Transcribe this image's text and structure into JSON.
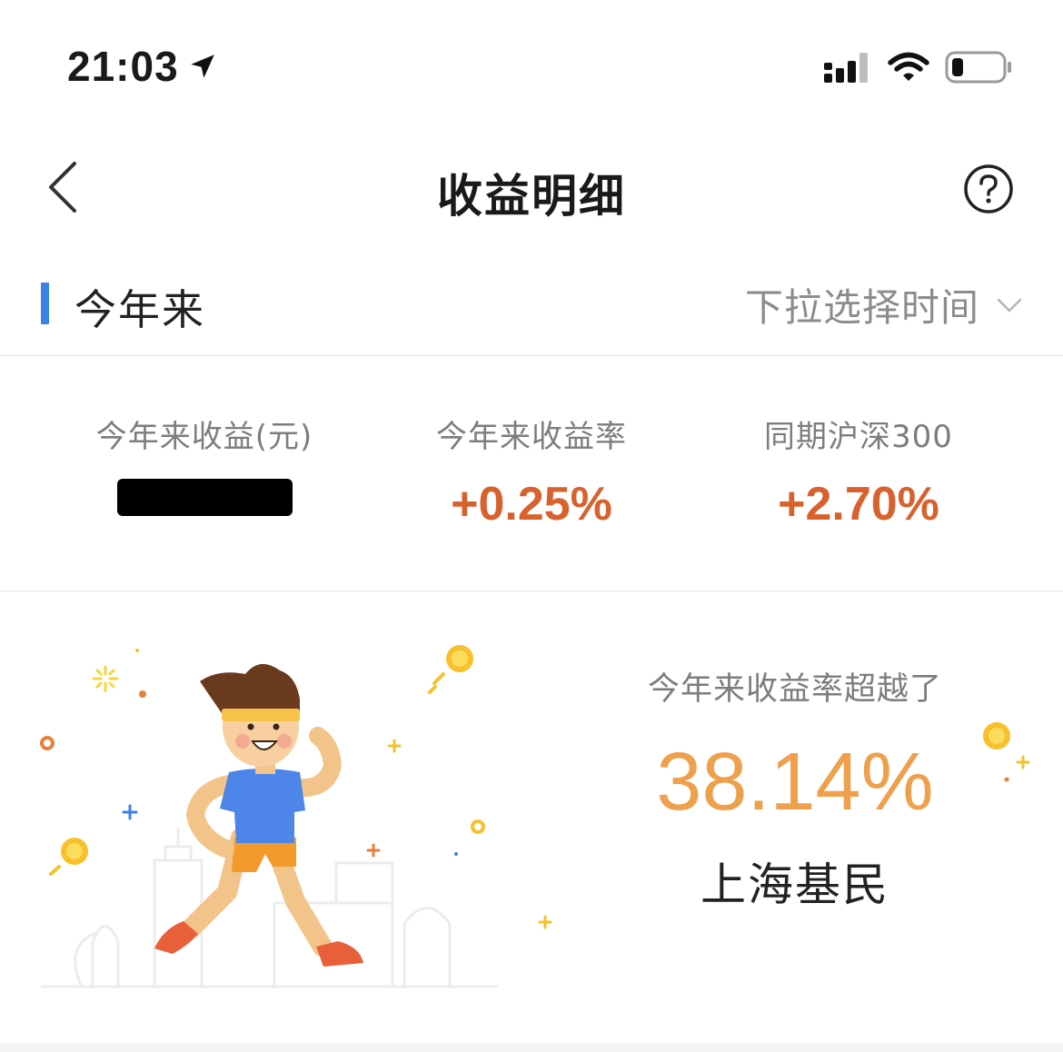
{
  "status_bar": {
    "time": "21:03",
    "icons": [
      "location-arrow-icon",
      "cellular-signal-icon",
      "wifi-icon",
      "battery-icon"
    ]
  },
  "nav": {
    "title": "收益明细",
    "back_icon": "chevron-left-icon",
    "help_icon": "question-circle-icon"
  },
  "period": {
    "label": "今年来",
    "select_placeholder": "下拉选择时间",
    "accent_color": "#3b82e6"
  },
  "stats": [
    {
      "label": "今年来收益(元)",
      "value": null,
      "redacted": true
    },
    {
      "label": "今年来收益率",
      "value": "+0.25%"
    },
    {
      "label": "同期沪深300",
      "value": "+2.70%"
    }
  ],
  "ranking": {
    "caption": "今年来收益率超越了",
    "percent": "38.14%",
    "audience": "上海基民",
    "value_color": "#eea04c"
  },
  "colors": {
    "gain": "#d8622e",
    "muted_text": "#7d7d7d"
  }
}
